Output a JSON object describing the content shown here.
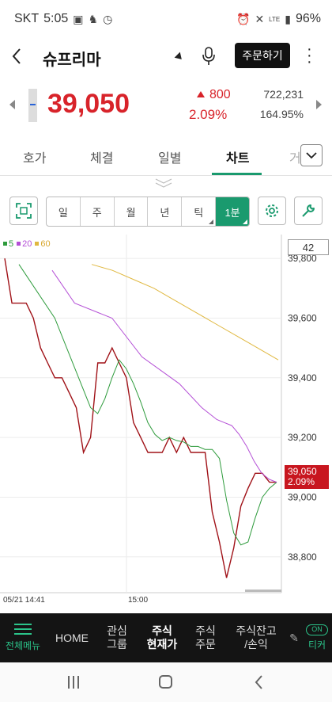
{
  "statusbar": {
    "carrier": "SKT",
    "time": "5:05",
    "battery": "96%",
    "lte_label": "LTE"
  },
  "header": {
    "stock_name": "슈프리마",
    "order_button": "주문하기"
  },
  "quote": {
    "price": "39,050",
    "change_amount": "800",
    "change_pct": "2.09%",
    "volume": "722,231",
    "volume_pct": "164.95%",
    "color_up": "#d8232a"
  },
  "tabs": [
    {
      "label": "호가"
    },
    {
      "label": "체결"
    },
    {
      "label": "일별"
    },
    {
      "label": "차트",
      "active": true
    },
    {
      "label": "거"
    }
  ],
  "periods": [
    {
      "label": "일"
    },
    {
      "label": "주"
    },
    {
      "label": "월"
    },
    {
      "label": "년"
    },
    {
      "label": "틱",
      "has_menu": true
    },
    {
      "label": "1분",
      "active": true,
      "has_menu": true
    }
  ],
  "legend": {
    "ma5": "5",
    "ma20": "20",
    "ma60": "60",
    "ma5_color": "#2e9b3c",
    "ma20_color": "#b44fd6",
    "ma60_color": "#e0b840"
  },
  "period_count": "42",
  "price_tag": {
    "price": "39,050",
    "pct": "2.09%"
  },
  "time_labels": {
    "start": "05/21 14:41",
    "mid": "15:00"
  },
  "chart_data": {
    "type": "line",
    "y_ticks": [
      "39,800",
      "39,600",
      "39,400",
      "39,200",
      "39,000",
      "38,800"
    ],
    "ylim": [
      38680,
      39880
    ],
    "series": [
      {
        "name": "price",
        "color": "#a01218",
        "values": [
          39800,
          39650,
          39650,
          39650,
          39600,
          39500,
          39450,
          39400,
          39400,
          39350,
          39300,
          39150,
          39200,
          39450,
          39450,
          39500,
          39450,
          39400,
          39250,
          39200,
          39150,
          39150,
          39150,
          39200,
          39150,
          39200,
          39150,
          39150,
          39150,
          38950,
          38850,
          38730,
          38830,
          38970,
          39030,
          39080,
          39080,
          39050,
          39050
        ]
      },
      {
        "name": "5",
        "color": "#2e9b3c",
        "values": [
          39780,
          null,
          null,
          null,
          null,
          39600,
          null,
          null,
          null,
          null,
          39300,
          39280,
          39330,
          39400,
          39460,
          39430,
          39380,
          39320,
          39250,
          39210,
          39190,
          39200,
          39190,
          39185,
          39170,
          39170,
          39160,
          39160,
          39130,
          38990,
          38880,
          38840,
          38850,
          38930,
          39000,
          39030,
          39050
        ]
      },
      {
        "name": "20",
        "color": "#b44fd6",
        "values": [
          39760,
          null,
          null,
          39650,
          null,
          null,
          null,
          null,
          39600,
          null,
          null,
          null,
          39470,
          null,
          null,
          null,
          null,
          39380,
          null,
          null,
          39300,
          39280,
          39260,
          39250,
          39240,
          39210,
          39170,
          39120,
          39080,
          39060,
          39050
        ]
      },
      {
        "name": "60",
        "color": "#e0b840",
        "values": [
          39780,
          39760,
          39730,
          39700,
          39660,
          39620,
          39580,
          39540,
          39500,
          39460
        ]
      }
    ]
  }
}
